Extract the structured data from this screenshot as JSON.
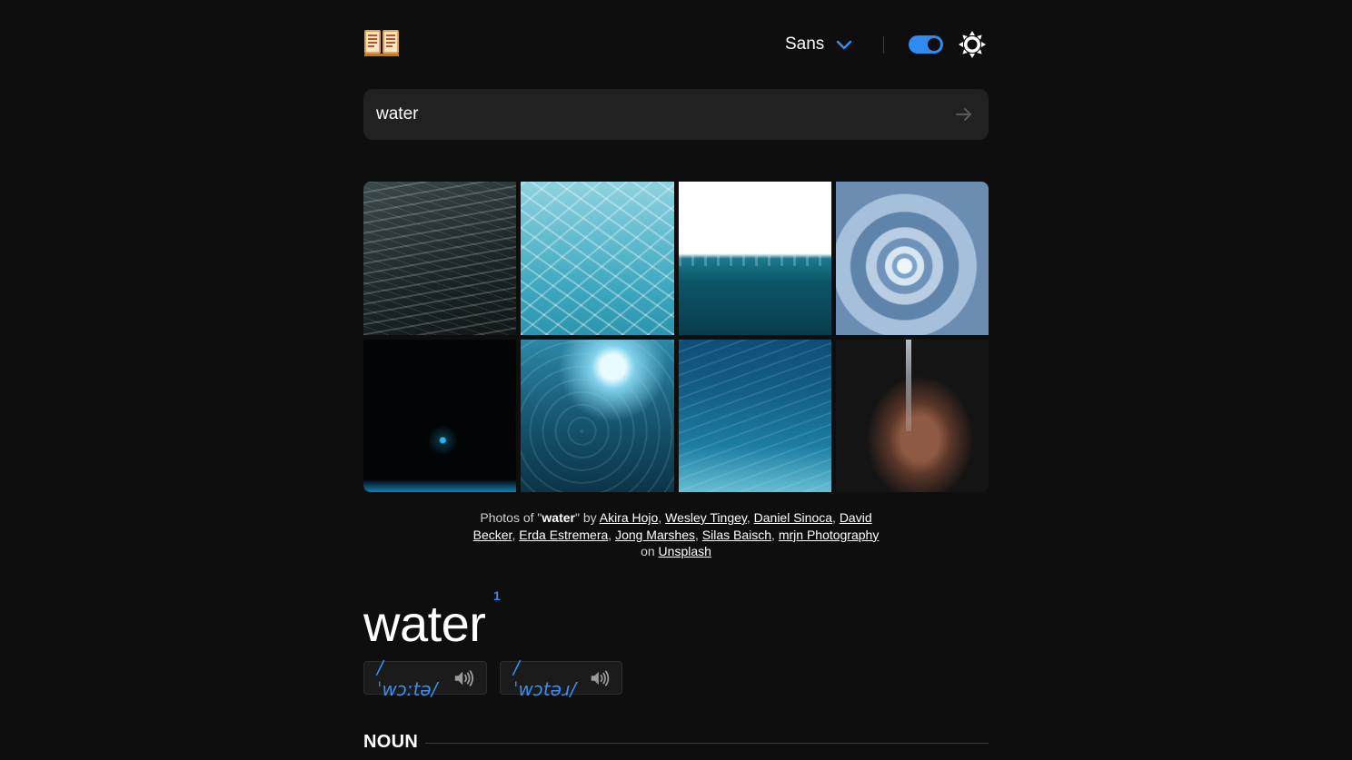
{
  "header": {
    "font_label": "Sans",
    "theme_toggle_state": "on"
  },
  "search": {
    "value": "water",
    "placeholder": ""
  },
  "gallery": {
    "images": [
      "water-ripples-dark",
      "pool-caustics",
      "underwater-surface-split",
      "water-drop-splash",
      "drop-on-black",
      "underwater-sunlight-bubbles",
      "deep-sea-underwater",
      "hands-catching-water"
    ]
  },
  "credit": {
    "prefix": "Photos of \"",
    "query": "water",
    "by": "\" by ",
    "photographers": [
      "Akira Hojo",
      "Wesley Tingey",
      "Daniel Sinoca",
      "David Becker",
      "Erda Estremera",
      "Jong Marshes",
      "Silas Baisch",
      "mrjn Photography"
    ],
    "on": "on",
    "source": "Unsplash"
  },
  "entry": {
    "word": "water",
    "superscript": "1",
    "pronunciations": [
      {
        "text": "/ ˈwɔːtə/"
      },
      {
        "text": "/ ˈwɔtəɹ/"
      }
    ],
    "part_of_speech": "NOUN"
  },
  "colors": {
    "accent": "#2f8bf0",
    "background": "#0e0e0f",
    "surface": "#212122"
  }
}
